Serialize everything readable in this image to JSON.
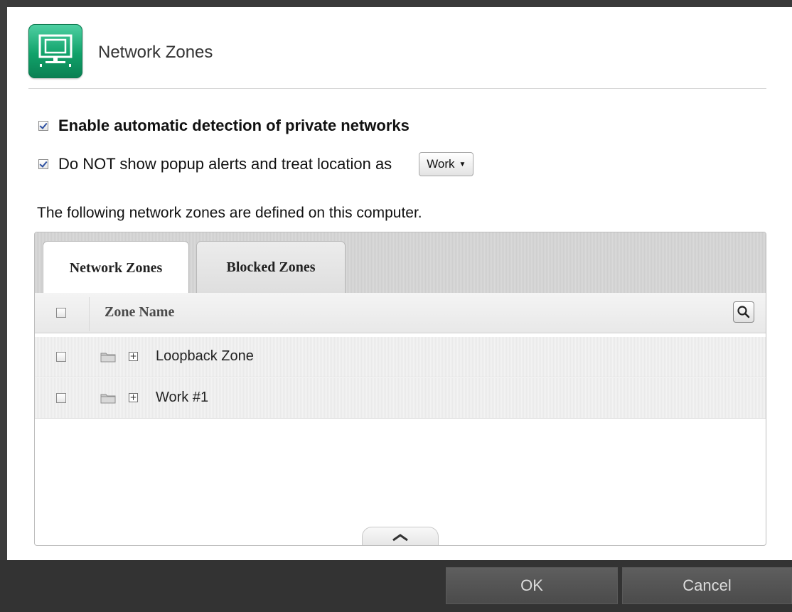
{
  "dialog": {
    "title": "Network Zones",
    "icon": "network-monitor-icon",
    "accent_color": "#11a26a"
  },
  "options": {
    "auto_detect": {
      "label": "Enable automatic detection of private networks",
      "checked": true
    },
    "no_popup": {
      "label": "Do NOT show popup alerts and treat location as",
      "checked": true,
      "location_value": "Work"
    }
  },
  "info_text": "The following network zones are defined on this computer.",
  "tabs": [
    {
      "label": "Network Zones",
      "active": true
    },
    {
      "label": "Blocked Zones",
      "active": false
    }
  ],
  "table": {
    "column_header": "Zone Name",
    "rows": [
      {
        "name": "Loopback Zone",
        "icon": "folder-icon",
        "checked": false
      },
      {
        "name": "Work #1",
        "icon": "folder-icon",
        "checked": false
      }
    ]
  },
  "footer": {
    "ok_label": "OK",
    "cancel_label": "Cancel"
  }
}
